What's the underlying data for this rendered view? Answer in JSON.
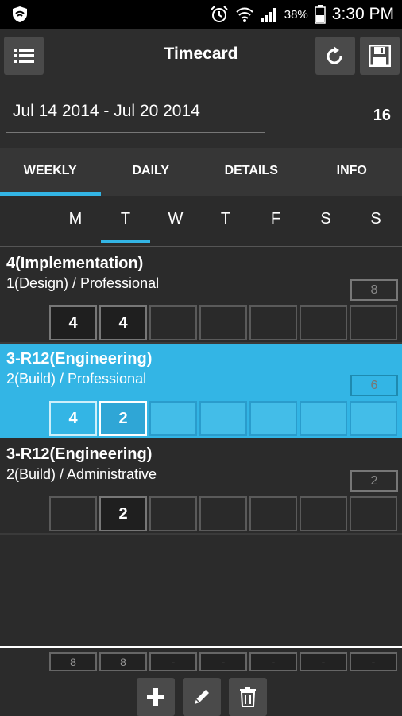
{
  "status": {
    "battery": "38%",
    "time": "3:30 PM"
  },
  "header": {
    "title": "Timecard"
  },
  "period": {
    "range": "Jul 14 2014 - Jul 20 2014",
    "count": "16"
  },
  "tabs": [
    {
      "label": "WEEKLY",
      "active": true
    },
    {
      "label": "DAILY",
      "active": false
    },
    {
      "label": "DETAILS",
      "active": false
    },
    {
      "label": "INFO",
      "active": false
    }
  ],
  "days": [
    "M",
    "T",
    "W",
    "T",
    "F",
    "S",
    "S"
  ],
  "rows": [
    {
      "title": "4(Implementation)",
      "subtitle": "1(Design) / Professional",
      "total": "8",
      "hours": [
        "4",
        "4",
        "",
        "",
        "",
        "",
        ""
      ],
      "selected": false
    },
    {
      "title": "3-R12(Engineering)",
      "subtitle": "2(Build) / Professional",
      "total": "6",
      "hours": [
        "4",
        "2",
        "",
        "",
        "",
        "",
        ""
      ],
      "selected": true
    },
    {
      "title": "3-R12(Engineering)",
      "subtitle": "2(Build) / Administrative",
      "total": "2",
      "hours": [
        "",
        "2",
        "",
        "",
        "",
        "",
        ""
      ],
      "selected": false
    }
  ],
  "totals": [
    "8",
    "8",
    "-",
    "-",
    "-",
    "-",
    "-"
  ],
  "colors": {
    "accent": "#33b5e5",
    "background": "#2b2b2b"
  }
}
